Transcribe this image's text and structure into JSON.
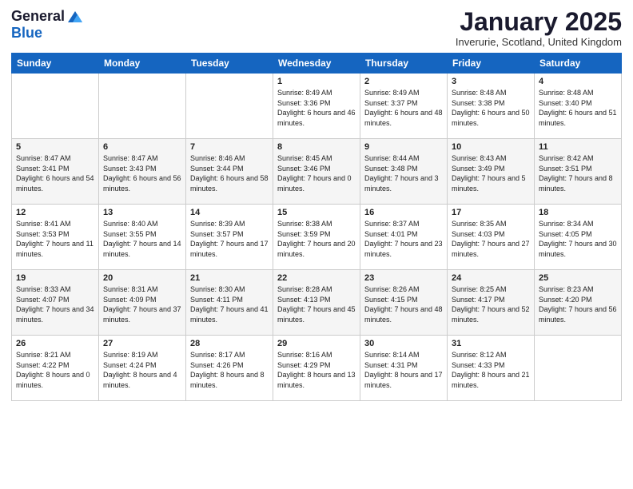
{
  "header": {
    "logo_general": "General",
    "logo_blue": "Blue",
    "month_title": "January 2025",
    "subtitle": "Inverurie, Scotland, United Kingdom"
  },
  "weekdays": [
    "Sunday",
    "Monday",
    "Tuesday",
    "Wednesday",
    "Thursday",
    "Friday",
    "Saturday"
  ],
  "weeks": [
    [
      {
        "day": "",
        "sunrise": "",
        "sunset": "",
        "daylight": ""
      },
      {
        "day": "",
        "sunrise": "",
        "sunset": "",
        "daylight": ""
      },
      {
        "day": "",
        "sunrise": "",
        "sunset": "",
        "daylight": ""
      },
      {
        "day": "1",
        "sunrise": "Sunrise: 8:49 AM",
        "sunset": "Sunset: 3:36 PM",
        "daylight": "Daylight: 6 hours and 46 minutes."
      },
      {
        "day": "2",
        "sunrise": "Sunrise: 8:49 AM",
        "sunset": "Sunset: 3:37 PM",
        "daylight": "Daylight: 6 hours and 48 minutes."
      },
      {
        "day": "3",
        "sunrise": "Sunrise: 8:48 AM",
        "sunset": "Sunset: 3:38 PM",
        "daylight": "Daylight: 6 hours and 50 minutes."
      },
      {
        "day": "4",
        "sunrise": "Sunrise: 8:48 AM",
        "sunset": "Sunset: 3:40 PM",
        "daylight": "Daylight: 6 hours and 51 minutes."
      }
    ],
    [
      {
        "day": "5",
        "sunrise": "Sunrise: 8:47 AM",
        "sunset": "Sunset: 3:41 PM",
        "daylight": "Daylight: 6 hours and 54 minutes."
      },
      {
        "day": "6",
        "sunrise": "Sunrise: 8:47 AM",
        "sunset": "Sunset: 3:43 PM",
        "daylight": "Daylight: 6 hours and 56 minutes."
      },
      {
        "day": "7",
        "sunrise": "Sunrise: 8:46 AM",
        "sunset": "Sunset: 3:44 PM",
        "daylight": "Daylight: 6 hours and 58 minutes."
      },
      {
        "day": "8",
        "sunrise": "Sunrise: 8:45 AM",
        "sunset": "Sunset: 3:46 PM",
        "daylight": "Daylight: 7 hours and 0 minutes."
      },
      {
        "day": "9",
        "sunrise": "Sunrise: 8:44 AM",
        "sunset": "Sunset: 3:48 PM",
        "daylight": "Daylight: 7 hours and 3 minutes."
      },
      {
        "day": "10",
        "sunrise": "Sunrise: 8:43 AM",
        "sunset": "Sunset: 3:49 PM",
        "daylight": "Daylight: 7 hours and 5 minutes."
      },
      {
        "day": "11",
        "sunrise": "Sunrise: 8:42 AM",
        "sunset": "Sunset: 3:51 PM",
        "daylight": "Daylight: 7 hours and 8 minutes."
      }
    ],
    [
      {
        "day": "12",
        "sunrise": "Sunrise: 8:41 AM",
        "sunset": "Sunset: 3:53 PM",
        "daylight": "Daylight: 7 hours and 11 minutes."
      },
      {
        "day": "13",
        "sunrise": "Sunrise: 8:40 AM",
        "sunset": "Sunset: 3:55 PM",
        "daylight": "Daylight: 7 hours and 14 minutes."
      },
      {
        "day": "14",
        "sunrise": "Sunrise: 8:39 AM",
        "sunset": "Sunset: 3:57 PM",
        "daylight": "Daylight: 7 hours and 17 minutes."
      },
      {
        "day": "15",
        "sunrise": "Sunrise: 8:38 AM",
        "sunset": "Sunset: 3:59 PM",
        "daylight": "Daylight: 7 hours and 20 minutes."
      },
      {
        "day": "16",
        "sunrise": "Sunrise: 8:37 AM",
        "sunset": "Sunset: 4:01 PM",
        "daylight": "Daylight: 7 hours and 23 minutes."
      },
      {
        "day": "17",
        "sunrise": "Sunrise: 8:35 AM",
        "sunset": "Sunset: 4:03 PM",
        "daylight": "Daylight: 7 hours and 27 minutes."
      },
      {
        "day": "18",
        "sunrise": "Sunrise: 8:34 AM",
        "sunset": "Sunset: 4:05 PM",
        "daylight": "Daylight: 7 hours and 30 minutes."
      }
    ],
    [
      {
        "day": "19",
        "sunrise": "Sunrise: 8:33 AM",
        "sunset": "Sunset: 4:07 PM",
        "daylight": "Daylight: 7 hours and 34 minutes."
      },
      {
        "day": "20",
        "sunrise": "Sunrise: 8:31 AM",
        "sunset": "Sunset: 4:09 PM",
        "daylight": "Daylight: 7 hours and 37 minutes."
      },
      {
        "day": "21",
        "sunrise": "Sunrise: 8:30 AM",
        "sunset": "Sunset: 4:11 PM",
        "daylight": "Daylight: 7 hours and 41 minutes."
      },
      {
        "day": "22",
        "sunrise": "Sunrise: 8:28 AM",
        "sunset": "Sunset: 4:13 PM",
        "daylight": "Daylight: 7 hours and 45 minutes."
      },
      {
        "day": "23",
        "sunrise": "Sunrise: 8:26 AM",
        "sunset": "Sunset: 4:15 PM",
        "daylight": "Daylight: 7 hours and 48 minutes."
      },
      {
        "day": "24",
        "sunrise": "Sunrise: 8:25 AM",
        "sunset": "Sunset: 4:17 PM",
        "daylight": "Daylight: 7 hours and 52 minutes."
      },
      {
        "day": "25",
        "sunrise": "Sunrise: 8:23 AM",
        "sunset": "Sunset: 4:20 PM",
        "daylight": "Daylight: 7 hours and 56 minutes."
      }
    ],
    [
      {
        "day": "26",
        "sunrise": "Sunrise: 8:21 AM",
        "sunset": "Sunset: 4:22 PM",
        "daylight": "Daylight: 8 hours and 0 minutes."
      },
      {
        "day": "27",
        "sunrise": "Sunrise: 8:19 AM",
        "sunset": "Sunset: 4:24 PM",
        "daylight": "Daylight: 8 hours and 4 minutes."
      },
      {
        "day": "28",
        "sunrise": "Sunrise: 8:17 AM",
        "sunset": "Sunset: 4:26 PM",
        "daylight": "Daylight: 8 hours and 8 minutes."
      },
      {
        "day": "29",
        "sunrise": "Sunrise: 8:16 AM",
        "sunset": "Sunset: 4:29 PM",
        "daylight": "Daylight: 8 hours and 13 minutes."
      },
      {
        "day": "30",
        "sunrise": "Sunrise: 8:14 AM",
        "sunset": "Sunset: 4:31 PM",
        "daylight": "Daylight: 8 hours and 17 minutes."
      },
      {
        "day": "31",
        "sunrise": "Sunrise: 8:12 AM",
        "sunset": "Sunset: 4:33 PM",
        "daylight": "Daylight: 8 hours and 21 minutes."
      },
      {
        "day": "",
        "sunrise": "",
        "sunset": "",
        "daylight": ""
      }
    ]
  ]
}
